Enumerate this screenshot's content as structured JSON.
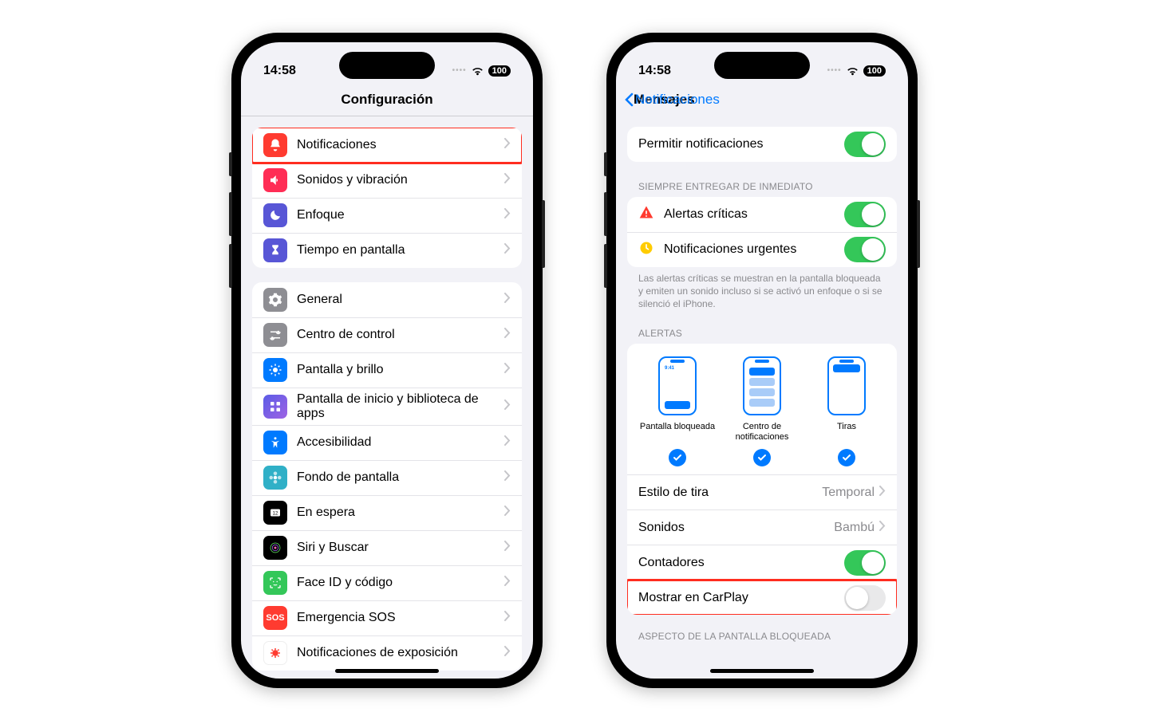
{
  "status": {
    "time": "14:58",
    "battery": "100"
  },
  "phone1": {
    "nav_title": "Configuración",
    "groups": [
      {
        "rows": [
          {
            "id": "notifications",
            "icon": "bell",
            "bg": "bg-red",
            "label": "Notificaciones",
            "highlight": true
          },
          {
            "id": "sounds",
            "icon": "speaker",
            "bg": "bg-pink",
            "label": "Sonidos y vibración"
          },
          {
            "id": "focus",
            "icon": "moon",
            "bg": "bg-purple",
            "label": "Enfoque"
          },
          {
            "id": "screentime",
            "icon": "hourglass",
            "bg": "bg-purple",
            "label": "Tiempo en pantalla"
          }
        ]
      },
      {
        "rows": [
          {
            "id": "general",
            "icon": "gear",
            "bg": "bg-gray",
            "label": "General"
          },
          {
            "id": "control-center",
            "icon": "sliders",
            "bg": "bg-gray",
            "label": "Centro de control"
          },
          {
            "id": "display",
            "icon": "sun",
            "bg": "bg-blue",
            "label": "Pantalla y brillo"
          },
          {
            "id": "home-screen",
            "icon": "grid",
            "bg": "bg-grad",
            "label": "Pantalla de inicio y biblioteca de apps"
          },
          {
            "id": "accessibility",
            "icon": "person",
            "bg": "bg-blue",
            "label": "Accesibilidad"
          },
          {
            "id": "wallpaper",
            "icon": "flower",
            "bg": "bg-teal",
            "label": "Fondo de pantalla"
          },
          {
            "id": "standby",
            "icon": "clock",
            "bg": "bg-black",
            "label": "En espera"
          },
          {
            "id": "siri",
            "icon": "siri",
            "bg": "bg-black",
            "label": "Siri y Buscar"
          },
          {
            "id": "faceid",
            "icon": "faceid",
            "bg": "bg-green",
            "label": "Face ID y código"
          },
          {
            "id": "sos",
            "icon": "sos",
            "bg": "bg-sos",
            "label": "Emergencia SOS"
          },
          {
            "id": "exposure",
            "icon": "virus",
            "bg": "bg-white",
            "label": "Notificaciones de exposición"
          }
        ]
      }
    ]
  },
  "phone2": {
    "nav_back": "Notificaciones",
    "nav_title": "Mensajes",
    "allow": {
      "label": "Permitir notificaciones",
      "on": true
    },
    "immediate_header": "SIEMPRE ENTREGAR DE INMEDIATO",
    "critical": {
      "label": "Alertas críticas",
      "on": true
    },
    "urgent": {
      "label": "Notificaciones urgentes",
      "on": true
    },
    "footer": "Las alertas críticas se muestran en la pantalla bloqueada y emiten un sonido incluso si se activó un enfoque o si se silenció el iPhone.",
    "alerts_header": "ALERTAS",
    "alerts_panel": {
      "lock": {
        "label": "Pantalla bloqueada",
        "checked": true,
        "time": "9:41"
      },
      "center": {
        "label": "Centro de notificaciones",
        "checked": true
      },
      "banner": {
        "label": "Tiras",
        "checked": true
      }
    },
    "banner_style": {
      "label": "Estilo de tira",
      "value": "Temporal"
    },
    "sounds": {
      "label": "Sonidos",
      "value": "Bambú"
    },
    "badges": {
      "label": "Contadores",
      "on": true
    },
    "carplay": {
      "label": "Mostrar en CarPlay",
      "on": false,
      "highlight": true
    },
    "lockscreen_header": "ASPECTO DE LA PANTALLA BLOQUEADA"
  }
}
